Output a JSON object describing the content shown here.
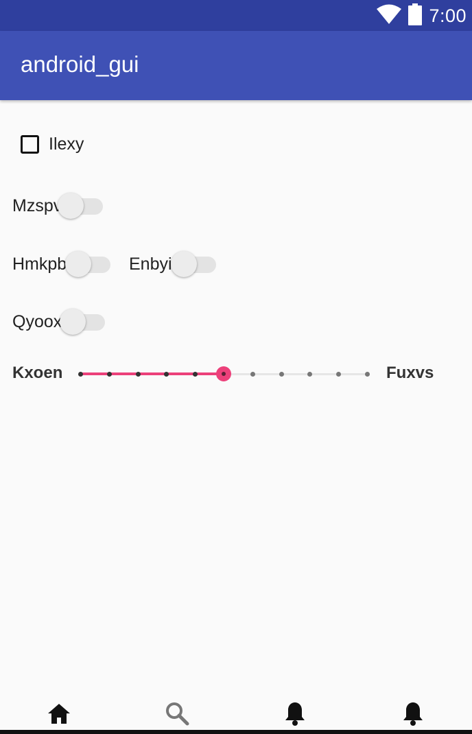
{
  "status_bar": {
    "time": "7:00",
    "icons": [
      "wifi-icon",
      "battery-icon"
    ]
  },
  "app_bar": {
    "title": "android_gui",
    "color": "#3f51b5"
  },
  "checkbox": {
    "label": "Ilexy",
    "checked": false
  },
  "switches": [
    {
      "label": "Mzspv",
      "on": false
    },
    {
      "label": "Hmkpb",
      "on": false
    },
    {
      "label": "Enbyi",
      "on": false
    },
    {
      "label": "Qyoox",
      "on": false
    }
  ],
  "slider": {
    "left_label": "Kxoen",
    "right_label": "Fuxvs",
    "steps": 10,
    "value": 5,
    "accent": "#ec407a"
  },
  "bottom_nav": {
    "items": [
      "home-icon",
      "search-icon",
      "bell-icon",
      "bell-icon"
    ],
    "selected": 0
  }
}
